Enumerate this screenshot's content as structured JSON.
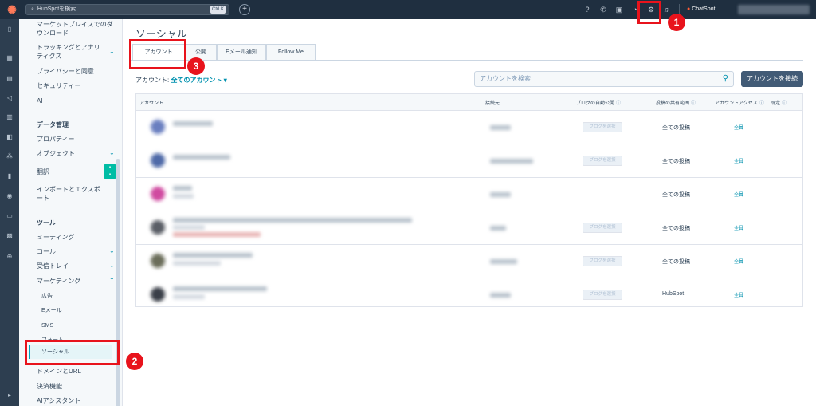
{
  "topbar": {
    "search_placeholder": "HubSpotを検索",
    "shortcut": "Ctrl K",
    "plus": "+",
    "chatspot": "ChatSpot"
  },
  "sidebar": {
    "items": [
      {
        "label": "マーケットプレイスでのダウンロード"
      },
      {
        "label": "トラッキングとアナリティクス"
      },
      {
        "label": "プライバシーと同意"
      },
      {
        "label": "セキュリティー"
      },
      {
        "label": "AI"
      },
      {
        "label": "データ管理"
      },
      {
        "label": "プロパティー"
      },
      {
        "label": "オブジェクト"
      },
      {
        "label": "翻訳"
      },
      {
        "label": "インポートとエクスポート"
      },
      {
        "label": "ツール"
      },
      {
        "label": "ミーティング"
      },
      {
        "label": "コール"
      },
      {
        "label": "受信トレイ"
      },
      {
        "label": "マーケティング"
      },
      {
        "label": "広告"
      },
      {
        "label": "Eメール"
      },
      {
        "label": "SMS"
      },
      {
        "label": "フォーム"
      },
      {
        "label": "ソーシャル"
      },
      {
        "label": "ドメインとURL"
      },
      {
        "label": "決済機能"
      },
      {
        "label": "AIアシスタント"
      }
    ]
  },
  "main": {
    "title": "ソーシャル",
    "tabs": [
      {
        "label": "アカウント"
      },
      {
        "label": "公開"
      },
      {
        "label": "Eメール通知"
      },
      {
        "label": "Follow Me"
      }
    ],
    "filter_label": "アカウント:",
    "filter_value": "全てのアカウント",
    "search_placeholder": "アカウントを検索",
    "connect_button": "アカウントを接続"
  },
  "table": {
    "headers": [
      "アカウント",
      "接続元",
      "ブログの自動公開",
      "投稿の共有範囲",
      "アカウントアクセス",
      "既定"
    ],
    "rows": [
      {
        "blog": "ブログを選択",
        "scope": "全ての投稿",
        "access": "全員"
      },
      {
        "blog": "ブログを選択",
        "scope": "全ての投稿",
        "access": "全員"
      },
      {
        "blog": "",
        "scope": "全ての投稿",
        "access": "全員"
      },
      {
        "blog": "ブログを選択",
        "scope": "全ての投稿",
        "access": "全員"
      },
      {
        "blog": "ブログを選択",
        "scope": "全ての投稿",
        "access": "全員"
      },
      {
        "blog": "ブログを選択",
        "scope": "HubSpot",
        "access": "全員"
      }
    ]
  },
  "annotations": [
    "1",
    "2",
    "3"
  ],
  "colors": {
    "topbar": "#1f2f40",
    "accent": "#00a4bd",
    "link": "#0091ae",
    "primary_button": "#425b76",
    "annotation_red": "#e8131c"
  }
}
